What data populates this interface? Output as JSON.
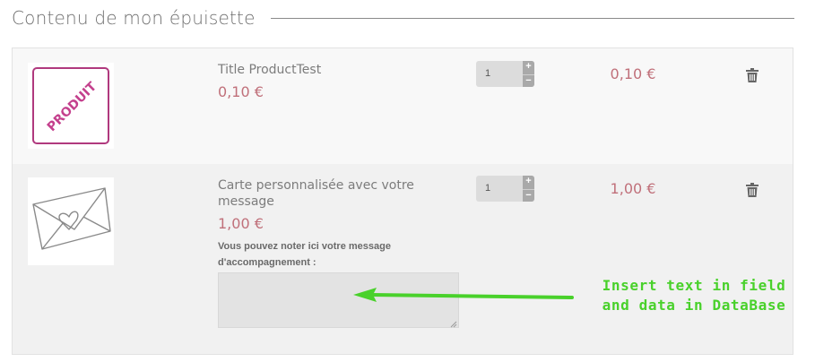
{
  "page": {
    "title": "Contenu de mon épuisette"
  },
  "items": [
    {
      "thumbnail_text": "PRODUIT",
      "name": "Title ProductTest",
      "price": "0,10 €",
      "quantity": "1",
      "total": "0,10 €"
    },
    {
      "name": "Carte personnalisée avec votre message",
      "price": "1,00 €",
      "quantity": "1",
      "total": "1,00 €",
      "message_label": "Vous pouvez noter ici votre message d'accompagnement :",
      "message_value": ""
    }
  ],
  "controls": {
    "qty_plus": "+",
    "qty_minus": "−"
  },
  "annotation": {
    "line1": "Insert text in field",
    "line2": "and data in DataBase"
  },
  "colors": {
    "price": "#c0707a",
    "annotation": "#49d12b",
    "produit_brand": "#b0397e"
  },
  "icons": {
    "delete": "trash-icon",
    "thumbnail1": "produit-logo",
    "thumbnail2": "envelope-heart-icon"
  }
}
